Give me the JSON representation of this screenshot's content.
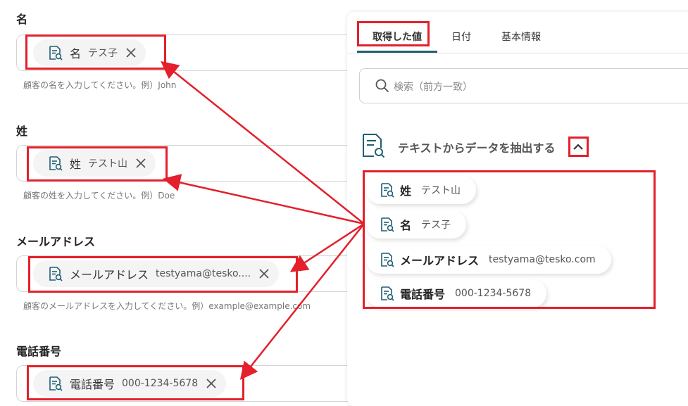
{
  "form": {
    "first_name": {
      "label": "名",
      "chip_name": "名",
      "chip_value": "テス子",
      "help": "顧客の名を入力してください。例）John"
    },
    "last_name": {
      "label": "姓",
      "chip_name": "姓",
      "chip_value": "テスト山",
      "help": "顧客の姓を入力してください。例）Doe"
    },
    "email": {
      "label": "メールアドレス",
      "chip_name": "メールアドレス",
      "chip_value": "testyama@tesko....",
      "help": "顧客のメールアドレスを入力してください。例）example@example.com"
    },
    "phone": {
      "label": "電話番号",
      "chip_name": "電話番号",
      "chip_value": "000-1234-5678"
    }
  },
  "panel": {
    "tabs": [
      "取得した値",
      "日付",
      "基本情報"
    ],
    "active_tab": "取得した値",
    "search_placeholder": "検索（前方一致）",
    "section_title": "テキストからデータを抽出する",
    "items": [
      {
        "name": "姓",
        "value": "テスト山"
      },
      {
        "name": "名",
        "value": "テス子"
      },
      {
        "name": "メールアドレス",
        "value": "testyama@tesko.com"
      },
      {
        "name": "電話番号",
        "value": "000-1234-5678"
      }
    ]
  },
  "icons": {
    "chip_icon": "document-search-icon",
    "remove_icon": "close-icon",
    "search_icon": "search-icon",
    "collapse_icon": "chevron-up-icon"
  },
  "colors": {
    "accent": "#1f5f73",
    "highlight": "#e3202b"
  }
}
